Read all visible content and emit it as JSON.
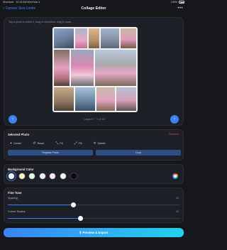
{
  "status_bar": {
    "left": "Shortcuts ·  12:19 AM  Wed Mar 4",
    "right": "100%"
  },
  "nav": {
    "back_label": "Canvas Size Limits",
    "title": "Collage Editor",
    "more": "•••"
  },
  "canvas": {
    "hint": "Tap a photo to select it, drag to reposition, drag to swap ...",
    "pager_label": "Layout 7 · 7 of 15"
  },
  "selected_photo": {
    "title": "Selected Photo",
    "remove_label": "Remove",
    "tools": [
      {
        "icon": "center-icon",
        "label": "Center"
      },
      {
        "icon": "reset-icon",
        "label": "Reset"
      },
      {
        "icon": "fit-icon",
        "label": "Fit"
      },
      {
        "icon": "fill-icon",
        "label": "Fill"
      },
      {
        "icon": "delete-icon",
        "label": "Delete"
      }
    ],
    "replace_label": "Replace Photo",
    "second_label": "Crop"
  },
  "background": {
    "title": "Background Color",
    "swatches": [
      "#ffffff",
      "#fef3c7",
      "#dcfce7",
      "#e0f2fe",
      "#fce7f3",
      "#f4f4f5",
      "#0b0b0f"
    ],
    "selected_index": 0
  },
  "fine_tune": {
    "title": "Fine Tune",
    "spacing_label": "Spacing",
    "spacing_value": "24",
    "spacing_fraction": 0.38,
    "radius_label": "Corner Radius",
    "radius_value": "28",
    "radius_fraction": 0.42
  },
  "cta": {
    "label": "Preview & Export"
  },
  "colors": {
    "accent": "#3b82f6",
    "danger": "#ef4444",
    "bg": "#16171b"
  }
}
